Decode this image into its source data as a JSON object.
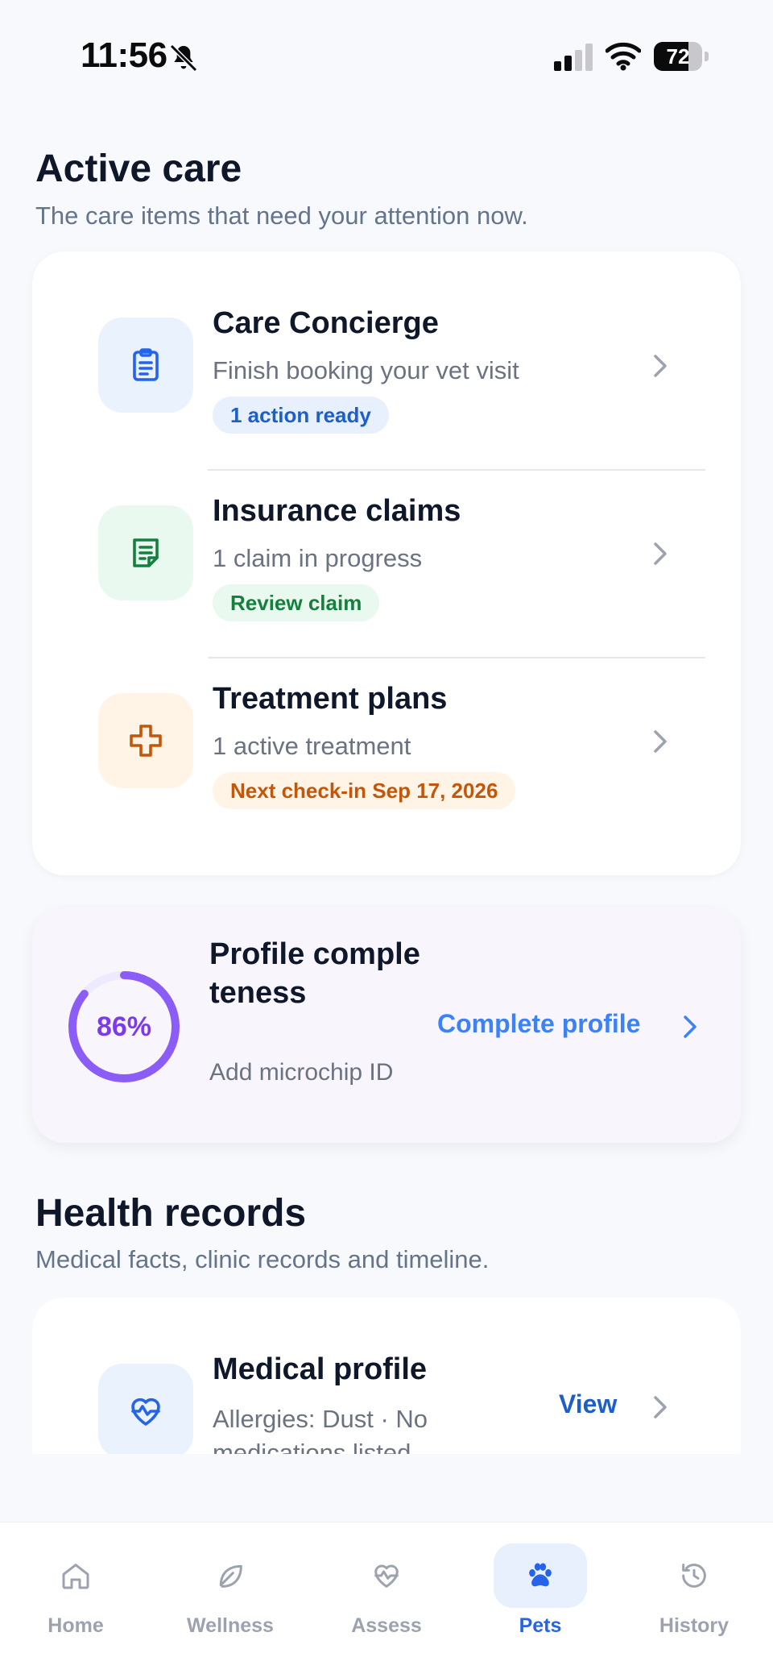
{
  "status_bar": {
    "time": "11:56",
    "battery": "72",
    "battery_level": 0.72
  },
  "active_care": {
    "title": "Active care",
    "subtitle": "The care items that need your attention now.",
    "items": [
      {
        "title": "Care Concierge",
        "subtitle": "Finish booking your vet visit",
        "badge": "1 action ready",
        "icon": "clipboard-icon"
      },
      {
        "title": "Insurance claims",
        "subtitle": "1 claim in progress",
        "badge": "Review claim",
        "icon": "document-icon"
      },
      {
        "title": "Treatment plans",
        "subtitle": "1 active treatment",
        "badge": "Next check-in Sep 17, 2026",
        "icon": "medical-cross-icon"
      }
    ]
  },
  "profile": {
    "percent_label": "86%",
    "percent": 86,
    "title": "Profile completeness",
    "subtitle": "Add microchip ID",
    "action": "Complete profile"
  },
  "health_records": {
    "title": "Health records",
    "subtitle": "Medical facts, clinic records and timeline.",
    "item": {
      "title": "Medical profile",
      "subtitle": "Allergies: Dust · No medications listed",
      "action": "View",
      "icon": "heart-pulse-icon"
    }
  },
  "tab_bar": {
    "tabs": [
      {
        "label": "Home",
        "icon": "home-icon"
      },
      {
        "label": "Wellness",
        "icon": "leaf-icon"
      },
      {
        "label": "Assess",
        "icon": "heart-pulse-icon"
      },
      {
        "label": "Pets",
        "icon": "paw-icon"
      },
      {
        "label": "History",
        "icon": "history-icon"
      }
    ],
    "active": "Pets"
  },
  "colors": {
    "accent_blue": "#2563eb",
    "green": "#15803d",
    "orange": "#c2570c",
    "purple": "#8b5cf6"
  }
}
